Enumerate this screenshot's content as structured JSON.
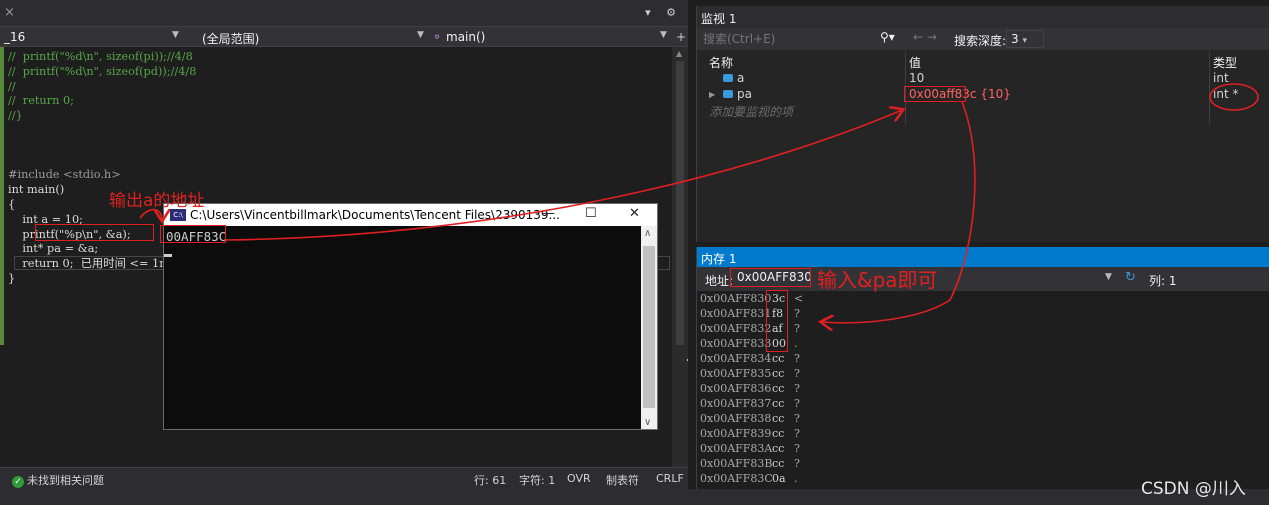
{
  "editor": {
    "tab_close": "×",
    "nav": {
      "file": "_16",
      "scope": "(全局范围)",
      "func": "main()"
    },
    "code_lines": [
      {
        "text": "//  printf(\"%d\\n\", sizeof(pi));//4/8",
        "cls": "cm"
      },
      {
        "text": "//  printf(\"%d\\n\", sizeof(pd));//4/8",
        "cls": "cm"
      },
      {
        "text": "//",
        "cls": "cm"
      },
      {
        "text": "//  return 0;",
        "cls": "cm"
      },
      {
        "text": "//}",
        "cls": "cm"
      },
      {
        "text": "",
        "cls": "plain"
      },
      {
        "text": "",
        "cls": "plain"
      },
      {
        "text": "",
        "cls": "plain"
      },
      {
        "text": "#include <stdio.h>",
        "cls": "pp"
      },
      {
        "text": "int main()",
        "cls": "plain"
      },
      {
        "text": "{",
        "cls": "plain"
      },
      {
        "text": "    int a = 10;",
        "cls": "plain"
      },
      {
        "text": "    printf(\"%p\\n\", &a);",
        "cls": "plain"
      },
      {
        "text": "    int* pa = &a;",
        "cls": "plain"
      },
      {
        "text": "    return 0;  已用时间 <= 1ms",
        "cls": "plain"
      },
      {
        "text": "}",
        "cls": "plain"
      }
    ],
    "status": {
      "issues": "未找到相关问题",
      "line": "行: 61",
      "char": "字符: 1",
      "ovr": "OVR",
      "tabs": "制表符",
      "crlf": "CRLF"
    }
  },
  "console": {
    "title": "C:\\Users\\Vincentbillmark\\Documents\\Tencent Files\\2390139...",
    "output": "00AFF83C",
    "btn_min": "—",
    "btn_max": "☐",
    "btn_close": "✕"
  },
  "watch": {
    "title": "监视 1",
    "search_placeholder": "搜索(Ctrl+E)",
    "depth_label": "搜索深度:",
    "depth_value": "3",
    "columns": [
      "名称",
      "值",
      "类型"
    ],
    "rows": [
      {
        "name": "a",
        "value": "10",
        "type": "int"
      },
      {
        "name": "pa",
        "value": "0x00aff83c {10}",
        "type": "int *"
      }
    ],
    "add_hint": "添加要监视的项"
  },
  "memory": {
    "title": "内存 1",
    "addr_label": "地址:",
    "addr_value": "0x00AFF830",
    "col_label": "列: 1",
    "rows": [
      {
        "addr": "0x00AFF830",
        "hex": "3c",
        "ch": "<"
      },
      {
        "addr": "0x00AFF831",
        "hex": "f8",
        "ch": "?"
      },
      {
        "addr": "0x00AFF832",
        "hex": "af",
        "ch": "?"
      },
      {
        "addr": "0x00AFF833",
        "hex": "00",
        "ch": "."
      },
      {
        "addr": "0x00AFF834",
        "hex": "cc",
        "ch": "?"
      },
      {
        "addr": "0x00AFF835",
        "hex": "cc",
        "ch": "?"
      },
      {
        "addr": "0x00AFF836",
        "hex": "cc",
        "ch": "?"
      },
      {
        "addr": "0x00AFF837",
        "hex": "cc",
        "ch": "?"
      },
      {
        "addr": "0x00AFF838",
        "hex": "cc",
        "ch": "?"
      },
      {
        "addr": "0x00AFF839",
        "hex": "cc",
        "ch": "?"
      },
      {
        "addr": "0x00AFF83A",
        "hex": "cc",
        "ch": "?"
      },
      {
        "addr": "0x00AFF83B",
        "hex": "cc",
        "ch": "?"
      },
      {
        "addr": "0x00AFF83C",
        "hex": "0a",
        "ch": "."
      }
    ]
  },
  "annotations": {
    "print_addr": "输出a的地址",
    "input_pa": "输入&pa即可",
    "color": "#e02020"
  },
  "watermark": "CSDN @川入"
}
